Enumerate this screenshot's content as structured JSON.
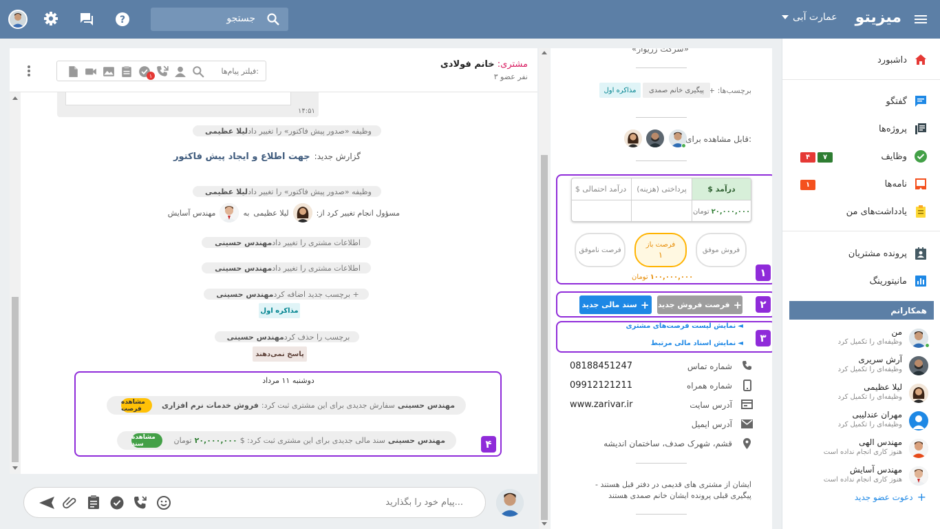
{
  "topbar": {
    "brand": "میزیتو",
    "company": "عمارت آبی",
    "search_placeholder": "جستجو"
  },
  "sidenav": {
    "items": [
      {
        "label": "داشبورد",
        "icon": "home-icon",
        "color": "#e53935"
      },
      {
        "label": "گفتگو",
        "icon": "chat-icon",
        "color": "#1e88e5"
      },
      {
        "label": "پروژه‌ها",
        "icon": "projects-icon",
        "color": "#37474f"
      },
      {
        "label": "وظایف",
        "icon": "tasks-check-icon",
        "color": "#43a047"
      },
      {
        "label": "نامه‌ها",
        "icon": "letters-icon",
        "color": "#f4511e"
      },
      {
        "label": "یادداشت‌های من",
        "icon": "notes-icon",
        "color": "#fdd835"
      },
      {
        "label": "پرونده مشتریان",
        "icon": "customers-icon",
        "color": "#455a64"
      },
      {
        "label": "مانیتورینگ",
        "icon": "monitoring-icon",
        "color": "#1e88e5"
      }
    ],
    "badges": {
      "tasks_red": "۴",
      "tasks_green": "۷",
      "letters_red": "۱"
    },
    "colleagues_title": "همکارانم",
    "colleagues": [
      {
        "name": "من",
        "status": "وظیفه‌ای را تکمیل کرد"
      },
      {
        "name": "آرش سریری",
        "status": "وظیفه‌ای را تکمیل کرد"
      },
      {
        "name": "لیلا عظیمی",
        "status": "وظیفه‌ای را تکمیل کرد"
      },
      {
        "name": "مهران عندلیبی",
        "status": "وظیفه‌ای را تکمیل کرد"
      },
      {
        "name": "مهندس الهی",
        "status": "هنوز کاری انجام نداده است"
      },
      {
        "name": "مهندس آسایش",
        "status": "هنوز کاری انجام نداده است"
      }
    ],
    "invite_label": "دعوت عضو جدید"
  },
  "infopanel": {
    "top_text": "«سرکت زریوار»",
    "tags_label": "برچسب‌ها:",
    "tags_plus": "+",
    "tags": [
      "پیگیری خانم صمدی",
      "مذاکره اول"
    ],
    "visible_label": "قابل مشاهده برای:",
    "finance": {
      "headers": [
        "$ درآمد",
        "پرداختی (هزینه)",
        "$ درآمد احتمالی"
      ],
      "income_value": "۲۰,۰۰۰,۰۰۰",
      "unit": "تومان"
    },
    "opportunities": [
      {
        "label": "فروش موفق"
      },
      {
        "label": "فرصت باز",
        "count": "۱"
      },
      {
        "label": "فرصت ناموفق"
      }
    ],
    "open_amount": "۱۰۰,۰۰۰,۰۰۰",
    "open_unit": "تومان",
    "btn_new_opportunity": "فرصت فروش جدید",
    "btn_new_document": "سند مالی جدید",
    "link_opportunities": "نمایش لیست فرصت‌های مشتری",
    "link_documents": "نمایش اسناد مالی مرتبط",
    "contacts": [
      {
        "label": "شماره تماس",
        "value": "08188451247",
        "icon": "phone-icon"
      },
      {
        "label": "شماره همراه",
        "value": "09912121211",
        "icon": "mobile-icon"
      },
      {
        "label": "آدرس سایت",
        "value": "www.zarivar.ir",
        "icon": "web-icon"
      },
      {
        "label": "آدرس ایمیل",
        "value": "",
        "icon": "email-icon"
      },
      {
        "label": "قشم، شهرک صدف، ساختمان اندیشه",
        "value": "",
        "icon": "location-icon"
      }
    ],
    "description_1": "ایشان از مشتری های قدیمی در دفتر قبل هستند -",
    "description_2": "پیگیری قبلی پرونده ایشان خانم صمدی هستند",
    "markers": [
      "۱",
      "۲",
      "۳"
    ]
  },
  "chat": {
    "customer_prefix": "مشتری:",
    "customer_name": "خانم فولادی",
    "members": "۳ نفر عضو",
    "filter_placeholder": "فیلتر پیام‌ها:",
    "filter_badge": "۱",
    "msg_time": "۱۴:۵۱",
    "events": [
      {
        "actor": "لیلا عظیمی",
        "text": "وظیفه «صدور پیش فاکتور» را تغییر داد"
      },
      {
        "actor": "لیلا عظیمی",
        "text": "وظیفه «صدور پیش فاکتور» را تغییر داد"
      },
      {
        "actor": "مهندس حسینی",
        "text": "اطلاعات مشتری را تغییر داد"
      },
      {
        "actor": "مهندس حسینی",
        "text": "اطلاعات مشتری را تغییر داد"
      },
      {
        "actor": "مهندس حسینی",
        "text": "برچسب جدید اضافه کرد +"
      },
      {
        "actor": "مهندس حسینی",
        "text": "برچسب را حذف کرد"
      }
    ],
    "report_label": "گزارش جدید:",
    "report_title": "جهت اطلاع و ایجاد پیش فاکتور",
    "assign_text": "مسؤول انجام تغییر کرد از:",
    "assign_from": "لیلا عظیمی",
    "assign_to_word": "به",
    "assign_to": "مهندس آسایش",
    "tag_added": "مذاکره اول",
    "tag_removed": "پاسخ نمی‌دهند",
    "date_header": "دوشنبه ۱۱ مرداد",
    "order_actor": "مهندس حسینی",
    "order_text": "سفارش جدیدی برای این مشتری ثبت کرد:",
    "order_title": "فروش خدمات نرم افزاری",
    "order_btn": "مشاهده فرصت",
    "doc_actor": "مهندس حسینی",
    "doc_text": "سند مالی جدیدی برای این مشتری ثبت کرد: $",
    "doc_amount": "۲۰,۰۰۰,۰۰۰",
    "doc_unit": "تومان",
    "doc_btn": "مشاهده سند",
    "marker": "۴"
  },
  "composer": {
    "placeholder": "پیام خود را بگذارید..."
  }
}
